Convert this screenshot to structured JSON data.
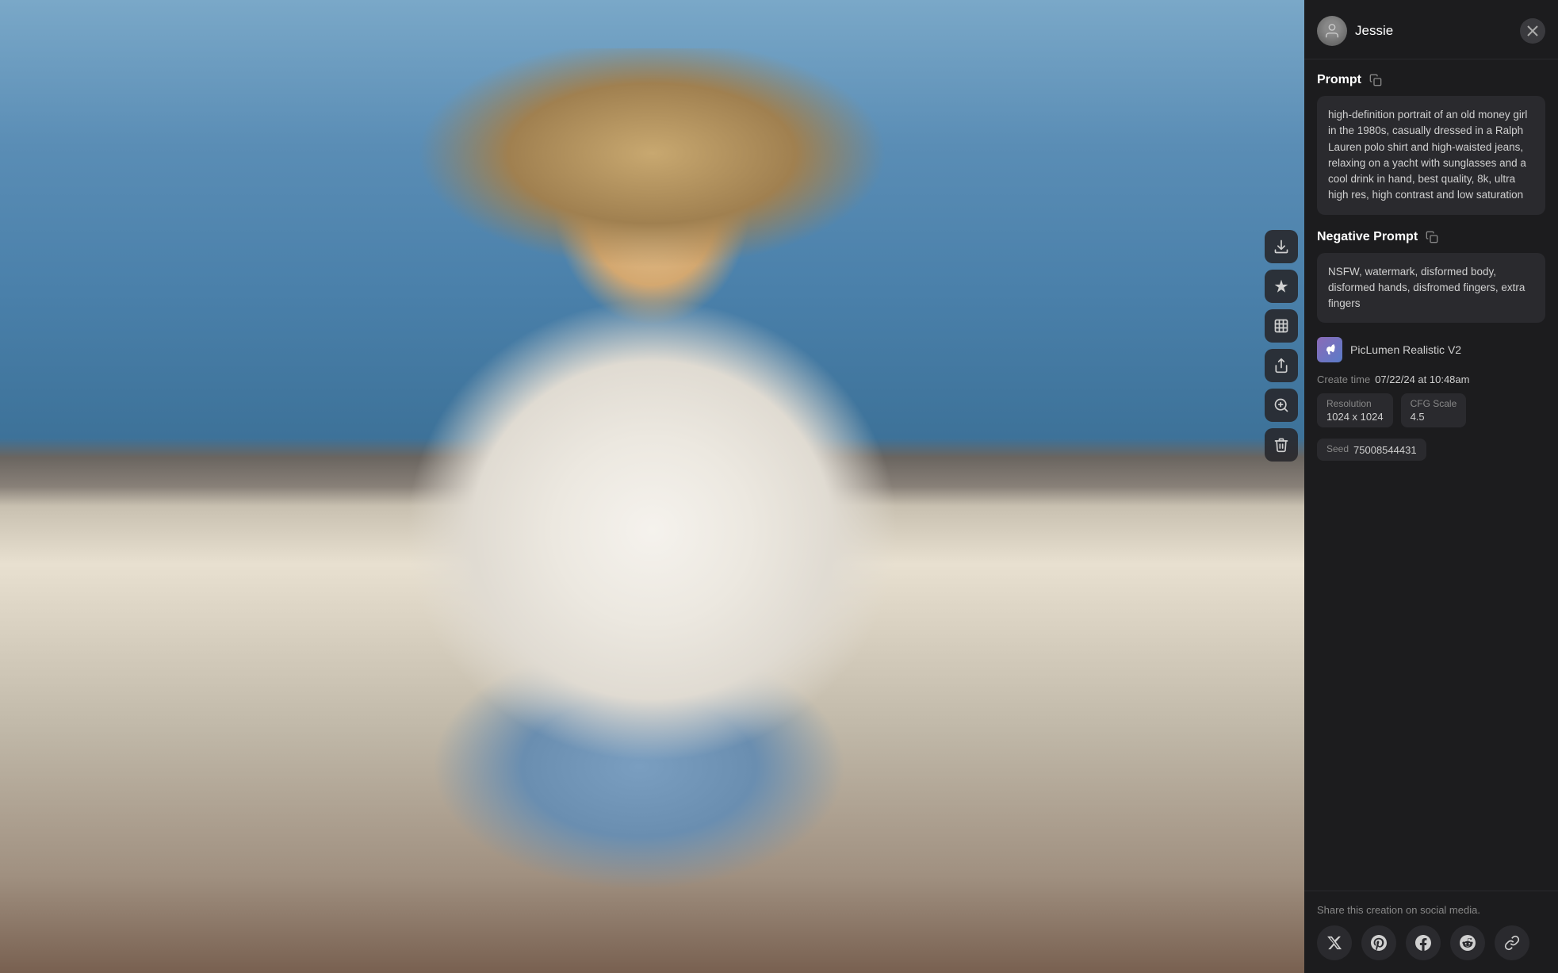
{
  "user": {
    "name": "Jessie"
  },
  "close_button": "×",
  "prompt": {
    "label": "Prompt",
    "text": "high-definition portrait of an old money girl in the 1980s, casually dressed in a Ralph Lauren polo shirt and high-waisted jeans, relaxing on a yacht with sunglasses and a cool drink in hand, best quality, 8k, ultra high res, high contrast and low saturation"
  },
  "negative_prompt": {
    "label": "Negative Prompt",
    "text": "NSFW, watermark, disformed body, disformed hands, disfromed fingers, extra fingers"
  },
  "model": {
    "name": "PicLumen Realistic V2"
  },
  "create_time": {
    "label": "Create time",
    "value": "07/22/24 at 10:48am"
  },
  "resolution": {
    "label": "Resolution",
    "value": "1024 x 1024"
  },
  "cfg_scale": {
    "label": "CFG Scale",
    "value": "4.5"
  },
  "seed": {
    "label": "Seed",
    "value": "75008544431"
  },
  "share": {
    "title": "Share this creation on social media.",
    "platforms": [
      "X",
      "Pinterest",
      "Facebook",
      "Reddit",
      "Link"
    ]
  },
  "actions": {
    "download": "download",
    "magic": "magic",
    "extend": "extend",
    "share": "share",
    "zoom": "zoom",
    "delete": "delete"
  }
}
